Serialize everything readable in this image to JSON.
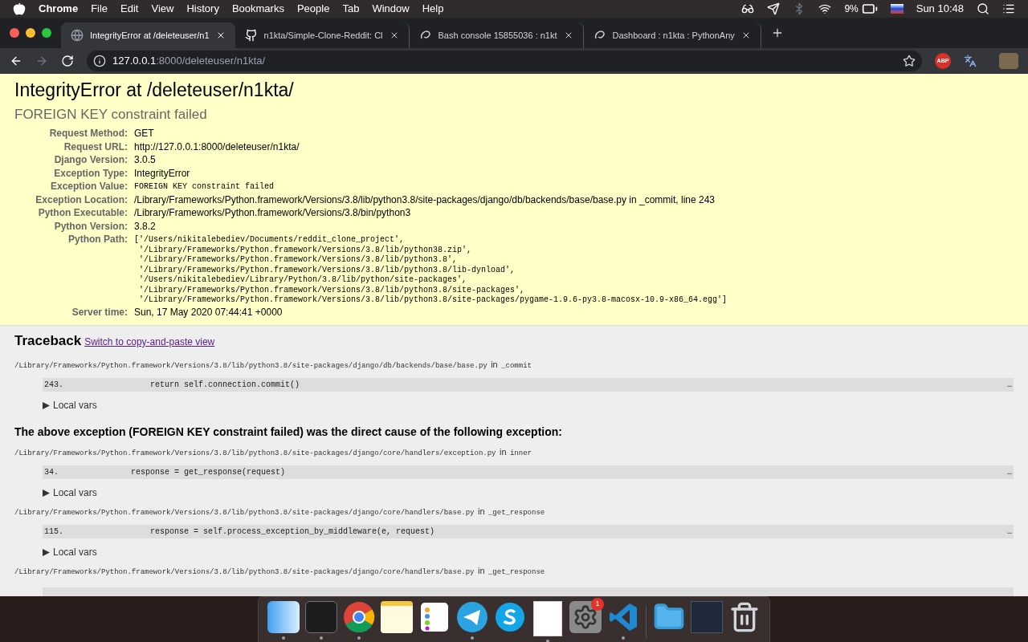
{
  "menu_bar": {
    "app": "Chrome",
    "items": [
      "File",
      "Edit",
      "View",
      "History",
      "Bookmarks",
      "People",
      "Tab",
      "Window",
      "Help"
    ],
    "battery": "9%",
    "clock": "Sun 10:48"
  },
  "tabs": [
    {
      "title": "IntegrityError at /deleteuser/n1",
      "kind": "globe",
      "selected": true
    },
    {
      "title": "n1kta/Simple-Clone-Reddit: Cl",
      "kind": "github",
      "selected": false
    },
    {
      "title": "Bash console 15855036 : n1kt",
      "kind": "swirl",
      "selected": false
    },
    {
      "title": "Dashboard : n1kta : PythonAny",
      "kind": "swirl",
      "selected": false
    }
  ],
  "address_bar": {
    "host": "127.0.0.1",
    "path": ":8000/deleteuser/n1kta/",
    "forward_disabled": true,
    "extension_badge": "ABP"
  },
  "summary": {
    "title": "IntegrityError at /deleteuser/n1kta/",
    "subtitle": "FOREIGN KEY constraint failed",
    "meta": [
      {
        "label": "Request Method:",
        "kind": "text",
        "lines": [
          "GET"
        ]
      },
      {
        "label": "Request URL:",
        "kind": "text",
        "lines": [
          "http://127.0.0.1:8000/deleteuser/n1kta/"
        ]
      },
      {
        "label": "Django Version:",
        "kind": "text",
        "lines": [
          "3.0.5"
        ]
      },
      {
        "label": "Exception Type:",
        "kind": "text",
        "lines": [
          "IntegrityError"
        ]
      },
      {
        "label": "Exception Value:",
        "kind": "code",
        "lines": [
          "FOREIGN KEY constraint failed"
        ]
      },
      {
        "label": "Exception Location:",
        "kind": "text",
        "lines": [
          "/Library/Frameworks/Python.framework/Versions/3.8/lib/python3.8/site-packages/django/db/backends/base/base.py in _commit, line 243"
        ]
      },
      {
        "label": "Python Executable:",
        "kind": "text",
        "lines": [
          "/Library/Frameworks/Python.framework/Versions/3.8/bin/python3"
        ]
      },
      {
        "label": "Python Version:",
        "kind": "text",
        "lines": [
          "3.8.2"
        ]
      },
      {
        "label": "Python Path:",
        "kind": "code",
        "lines": [
          "['/Users/nikitalebediev/Documents/reddit_clone_project',",
          " '/Library/Frameworks/Python.framework/Versions/3.8/lib/python38.zip',",
          " '/Library/Frameworks/Python.framework/Versions/3.8/lib/python3.8',",
          " '/Library/Frameworks/Python.framework/Versions/3.8/lib/python3.8/lib-dynload',",
          " '/Users/nikitalebediev/Library/Python/3.8/lib/python/site-packages',",
          " '/Library/Frameworks/Python.framework/Versions/3.8/lib/python3.8/site-packages',",
          " '/Library/Frameworks/Python.framework/Versions/3.8/lib/python3.8/site-packages/pygame-1.9.6-py3.8-macosx-10.9-x86_64.egg']"
        ]
      },
      {
        "label": "Server time:",
        "kind": "text",
        "lines": [
          "Sun, 17 May 2020 07:44:41 +0000"
        ]
      }
    ]
  },
  "traceback": {
    "title": "Traceback",
    "link": "Switch to copy-and-paste view",
    "sections": [
      {
        "kind": "frame",
        "file": "/Library/Frameworks/Python.framework/Versions/3.8/lib/python3.8/site-packages/django/db/backends/base/base.py",
        "in": "in",
        "func": "_commit",
        "line_no": "243.",
        "code": "            return self.connection.commit()",
        "ellipsis": "…",
        "local_vars": "Local vars"
      },
      {
        "kind": "cause",
        "text": "The above exception (FOREIGN KEY constraint failed) was the direct cause of the following exception:"
      },
      {
        "kind": "frame",
        "file": "/Library/Frameworks/Python.framework/Versions/3.8/lib/python3.8/site-packages/django/core/handlers/exception.py",
        "in": "in",
        "func": "inner",
        "line_no": "34.",
        "code": "        response = get_response(request)",
        "ellipsis": "…",
        "local_vars": "Local vars"
      },
      {
        "kind": "frame",
        "file": "/Library/Frameworks/Python.framework/Versions/3.8/lib/python3.8/site-packages/django/core/handlers/base.py",
        "in": "in",
        "func": "_get_response",
        "line_no": "115.",
        "code": "            response = self.process_exception_by_middleware(e, request)",
        "ellipsis": "…",
        "local_vars": "Local vars"
      },
      {
        "kind": "frame_cut",
        "file": "/Library/Frameworks/Python.framework/Versions/3.8/lib/python3.8/site-packages/django/core/handlers/base.py",
        "in": "in",
        "func": "_get_response"
      }
    ]
  },
  "dock": [
    {
      "kind": "finder",
      "running": true
    },
    {
      "kind": "terminal",
      "running": true
    },
    {
      "kind": "chrome",
      "running": true
    },
    {
      "kind": "notes",
      "running": false
    },
    {
      "kind": "reminders",
      "running": false
    },
    {
      "kind": "telegram",
      "running": true
    },
    {
      "kind": "skype",
      "running": false
    },
    {
      "kind": "document",
      "running": true
    },
    {
      "kind": "settings",
      "running": false,
      "badge": "1"
    },
    {
      "kind": "vscode",
      "running": true
    },
    {
      "kind": "separator"
    },
    {
      "kind": "folder",
      "running": false
    },
    {
      "kind": "screenshot",
      "running": false
    },
    {
      "kind": "trash",
      "running": false
    }
  ]
}
